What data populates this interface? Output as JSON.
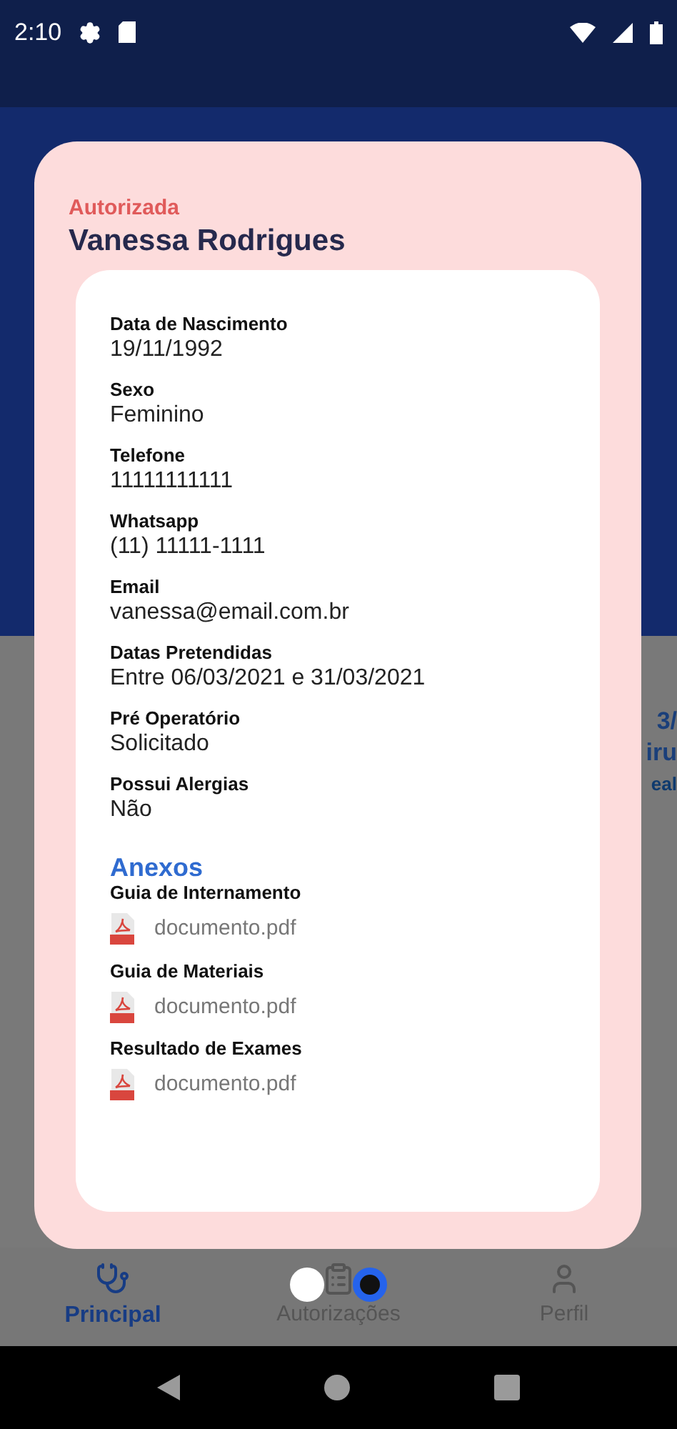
{
  "status_bar": {
    "time": "2:10"
  },
  "background": {
    "summary_texts": [
      "3/",
      "iru",
      "eal"
    ]
  },
  "modal": {
    "status": "Autorizada",
    "name": "Vanessa Rodrigues",
    "fields": [
      {
        "label": "Data de Nascimento",
        "value": "19/11/1992"
      },
      {
        "label": "Sexo",
        "value": "Feminino"
      },
      {
        "label": "Telefone",
        "value": "11111111111"
      },
      {
        "label": "Whatsapp",
        "value": "(11) 11111-1111"
      },
      {
        "label": "Email",
        "value": "vanessa@email.com.br"
      },
      {
        "label": "Datas Pretendidas",
        "value": "Entre 06/03/2021 e 31/03/2021"
      },
      {
        "label": "Pré Operatório",
        "value": "Solicitado"
      },
      {
        "label": "Possui Alergias",
        "value": "Não"
      }
    ],
    "attachments_title": "Anexos",
    "attachments": [
      {
        "label": "Guia de Internamento",
        "file": "documento.pdf"
      },
      {
        "label": "Guia de Materiais",
        "file": "documento.pdf"
      },
      {
        "label": "Resultado de Exames",
        "file": "documento.pdf"
      }
    ]
  },
  "bottom_nav": [
    {
      "label": "Principal",
      "selected": true
    },
    {
      "label": "Autorizações",
      "selected": false
    },
    {
      "label": "Perfil",
      "selected": false
    }
  ]
}
